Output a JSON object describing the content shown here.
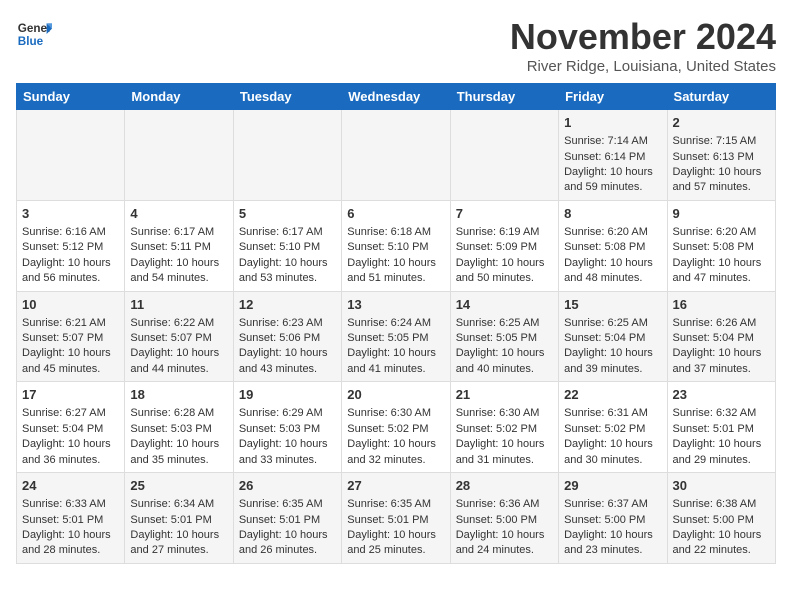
{
  "logo": {
    "line1": "General",
    "line2": "Blue"
  },
  "title": "November 2024",
  "location": "River Ridge, Louisiana, United States",
  "days_of_week": [
    "Sunday",
    "Monday",
    "Tuesday",
    "Wednesday",
    "Thursday",
    "Friday",
    "Saturday"
  ],
  "weeks": [
    [
      {
        "day": "",
        "sunrise": "",
        "sunset": "",
        "daylight": ""
      },
      {
        "day": "",
        "sunrise": "",
        "sunset": "",
        "daylight": ""
      },
      {
        "day": "",
        "sunrise": "",
        "sunset": "",
        "daylight": ""
      },
      {
        "day": "",
        "sunrise": "",
        "sunset": "",
        "daylight": ""
      },
      {
        "day": "",
        "sunrise": "",
        "sunset": "",
        "daylight": ""
      },
      {
        "day": "1",
        "sunrise": "Sunrise: 7:14 AM",
        "sunset": "Sunset: 6:14 PM",
        "daylight": "Daylight: 10 hours and 59 minutes."
      },
      {
        "day": "2",
        "sunrise": "Sunrise: 7:15 AM",
        "sunset": "Sunset: 6:13 PM",
        "daylight": "Daylight: 10 hours and 57 minutes."
      }
    ],
    [
      {
        "day": "3",
        "sunrise": "Sunrise: 6:16 AM",
        "sunset": "Sunset: 5:12 PM",
        "daylight": "Daylight: 10 hours and 56 minutes."
      },
      {
        "day": "4",
        "sunrise": "Sunrise: 6:17 AM",
        "sunset": "Sunset: 5:11 PM",
        "daylight": "Daylight: 10 hours and 54 minutes."
      },
      {
        "day": "5",
        "sunrise": "Sunrise: 6:17 AM",
        "sunset": "Sunset: 5:10 PM",
        "daylight": "Daylight: 10 hours and 53 minutes."
      },
      {
        "day": "6",
        "sunrise": "Sunrise: 6:18 AM",
        "sunset": "Sunset: 5:10 PM",
        "daylight": "Daylight: 10 hours and 51 minutes."
      },
      {
        "day": "7",
        "sunrise": "Sunrise: 6:19 AM",
        "sunset": "Sunset: 5:09 PM",
        "daylight": "Daylight: 10 hours and 50 minutes."
      },
      {
        "day": "8",
        "sunrise": "Sunrise: 6:20 AM",
        "sunset": "Sunset: 5:08 PM",
        "daylight": "Daylight: 10 hours and 48 minutes."
      },
      {
        "day": "9",
        "sunrise": "Sunrise: 6:20 AM",
        "sunset": "Sunset: 5:08 PM",
        "daylight": "Daylight: 10 hours and 47 minutes."
      }
    ],
    [
      {
        "day": "10",
        "sunrise": "Sunrise: 6:21 AM",
        "sunset": "Sunset: 5:07 PM",
        "daylight": "Daylight: 10 hours and 45 minutes."
      },
      {
        "day": "11",
        "sunrise": "Sunrise: 6:22 AM",
        "sunset": "Sunset: 5:07 PM",
        "daylight": "Daylight: 10 hours and 44 minutes."
      },
      {
        "day": "12",
        "sunrise": "Sunrise: 6:23 AM",
        "sunset": "Sunset: 5:06 PM",
        "daylight": "Daylight: 10 hours and 43 minutes."
      },
      {
        "day": "13",
        "sunrise": "Sunrise: 6:24 AM",
        "sunset": "Sunset: 5:05 PM",
        "daylight": "Daylight: 10 hours and 41 minutes."
      },
      {
        "day": "14",
        "sunrise": "Sunrise: 6:25 AM",
        "sunset": "Sunset: 5:05 PM",
        "daylight": "Daylight: 10 hours and 40 minutes."
      },
      {
        "day": "15",
        "sunrise": "Sunrise: 6:25 AM",
        "sunset": "Sunset: 5:04 PM",
        "daylight": "Daylight: 10 hours and 39 minutes."
      },
      {
        "day": "16",
        "sunrise": "Sunrise: 6:26 AM",
        "sunset": "Sunset: 5:04 PM",
        "daylight": "Daylight: 10 hours and 37 minutes."
      }
    ],
    [
      {
        "day": "17",
        "sunrise": "Sunrise: 6:27 AM",
        "sunset": "Sunset: 5:04 PM",
        "daylight": "Daylight: 10 hours and 36 minutes."
      },
      {
        "day": "18",
        "sunrise": "Sunrise: 6:28 AM",
        "sunset": "Sunset: 5:03 PM",
        "daylight": "Daylight: 10 hours and 35 minutes."
      },
      {
        "day": "19",
        "sunrise": "Sunrise: 6:29 AM",
        "sunset": "Sunset: 5:03 PM",
        "daylight": "Daylight: 10 hours and 33 minutes."
      },
      {
        "day": "20",
        "sunrise": "Sunrise: 6:30 AM",
        "sunset": "Sunset: 5:02 PM",
        "daylight": "Daylight: 10 hours and 32 minutes."
      },
      {
        "day": "21",
        "sunrise": "Sunrise: 6:30 AM",
        "sunset": "Sunset: 5:02 PM",
        "daylight": "Daylight: 10 hours and 31 minutes."
      },
      {
        "day": "22",
        "sunrise": "Sunrise: 6:31 AM",
        "sunset": "Sunset: 5:02 PM",
        "daylight": "Daylight: 10 hours and 30 minutes."
      },
      {
        "day": "23",
        "sunrise": "Sunrise: 6:32 AM",
        "sunset": "Sunset: 5:01 PM",
        "daylight": "Daylight: 10 hours and 29 minutes."
      }
    ],
    [
      {
        "day": "24",
        "sunrise": "Sunrise: 6:33 AM",
        "sunset": "Sunset: 5:01 PM",
        "daylight": "Daylight: 10 hours and 28 minutes."
      },
      {
        "day": "25",
        "sunrise": "Sunrise: 6:34 AM",
        "sunset": "Sunset: 5:01 PM",
        "daylight": "Daylight: 10 hours and 27 minutes."
      },
      {
        "day": "26",
        "sunrise": "Sunrise: 6:35 AM",
        "sunset": "Sunset: 5:01 PM",
        "daylight": "Daylight: 10 hours and 26 minutes."
      },
      {
        "day": "27",
        "sunrise": "Sunrise: 6:35 AM",
        "sunset": "Sunset: 5:01 PM",
        "daylight": "Daylight: 10 hours and 25 minutes."
      },
      {
        "day": "28",
        "sunrise": "Sunrise: 6:36 AM",
        "sunset": "Sunset: 5:00 PM",
        "daylight": "Daylight: 10 hours and 24 minutes."
      },
      {
        "day": "29",
        "sunrise": "Sunrise: 6:37 AM",
        "sunset": "Sunset: 5:00 PM",
        "daylight": "Daylight: 10 hours and 23 minutes."
      },
      {
        "day": "30",
        "sunrise": "Sunrise: 6:38 AM",
        "sunset": "Sunset: 5:00 PM",
        "daylight": "Daylight: 10 hours and 22 minutes."
      }
    ]
  ]
}
